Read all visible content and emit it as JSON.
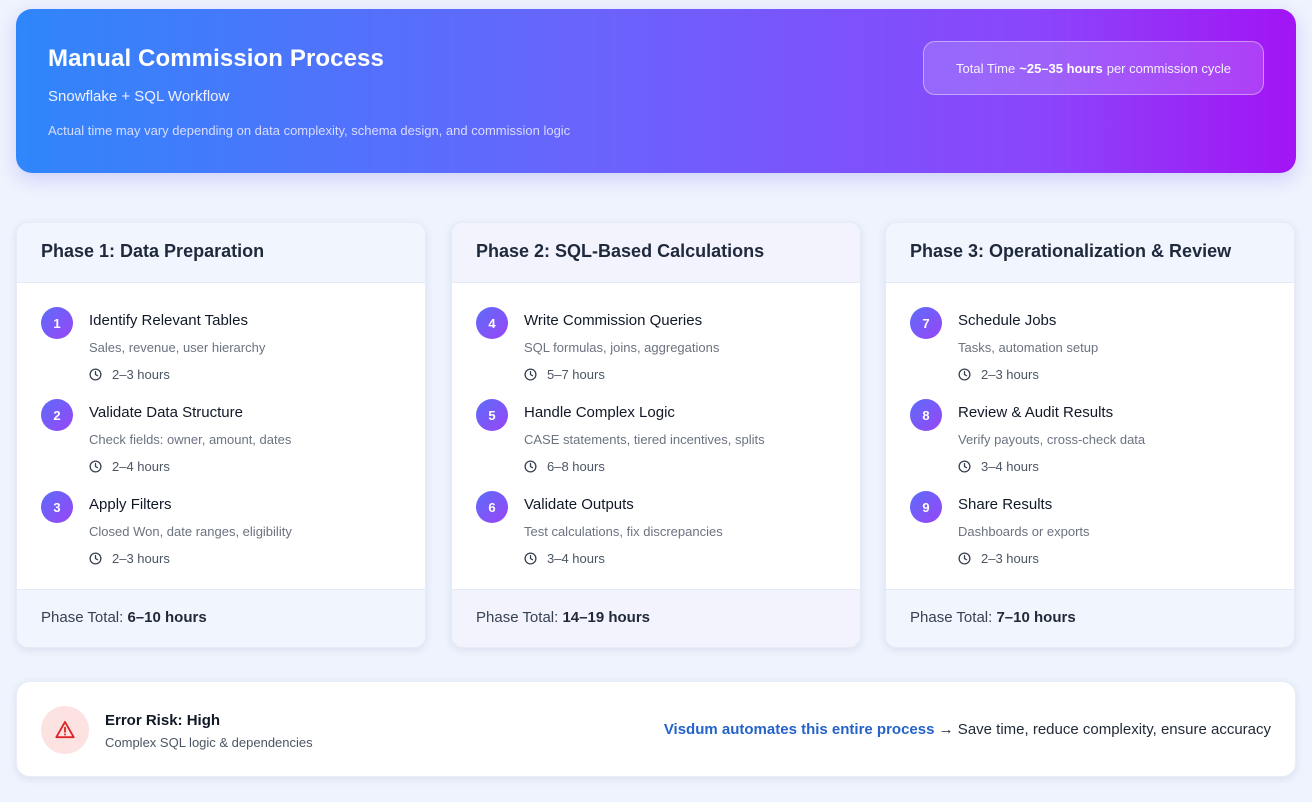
{
  "header": {
    "title": "Manual Commission Process",
    "subtitle": "Snowflake + SQL Workflow",
    "note": "Actual time may vary depending on data complexity, schema design, and commission logic",
    "total_time": {
      "prefix": "Total Time",
      "value": "~25–35 hours",
      "suffix": "per commission cycle"
    }
  },
  "phases": [
    {
      "title": "Phase 1: Data Preparation",
      "steps": [
        {
          "num": "1",
          "title": "Identify Relevant Tables",
          "desc": "Sales, revenue, user hierarchy",
          "time": "2–3 hours"
        },
        {
          "num": "2",
          "title": "Validate Data Structure",
          "desc": "Check fields: owner, amount, dates",
          "time": "2–4 hours"
        },
        {
          "num": "3",
          "title": "Apply Filters",
          "desc": "Closed Won, date ranges, eligibility",
          "time": "2–3 hours"
        }
      ],
      "total_label": "Phase Total:",
      "total_value": "6–10 hours"
    },
    {
      "title": "Phase 2: SQL-Based Calculations",
      "steps": [
        {
          "num": "4",
          "title": "Write Commission Queries",
          "desc": "SQL formulas, joins, aggregations",
          "time": "5–7 hours"
        },
        {
          "num": "5",
          "title": "Handle Complex Logic",
          "desc": "CASE statements, tiered incentives, splits",
          "time": "6–8 hours"
        },
        {
          "num": "6",
          "title": "Validate Outputs",
          "desc": "Test calculations, fix discrepancies",
          "time": "3–4 hours"
        }
      ],
      "total_label": "Phase Total:",
      "total_value": "14–19 hours"
    },
    {
      "title": "Phase 3: Operationalization & Review",
      "steps": [
        {
          "num": "7",
          "title": "Schedule Jobs",
          "desc": "Tasks, automation setup",
          "time": "2–3 hours"
        },
        {
          "num": "8",
          "title": "Review & Audit Results",
          "desc": "Verify payouts, cross-check data",
          "time": "3–4 hours"
        },
        {
          "num": "9",
          "title": "Share Results",
          "desc": "Dashboards or exports",
          "time": "2–3 hours"
        }
      ],
      "total_label": "Phase Total:",
      "total_value": "7–10 hours"
    }
  ],
  "risk": {
    "icon": "warning-icon",
    "title": "Error Risk: High",
    "subtitle": "Complex SQL logic & dependencies",
    "cta_link": "Visdum automates this entire process",
    "cta_text": "→ Save time, reduce complexity, ensure accuracy"
  }
}
